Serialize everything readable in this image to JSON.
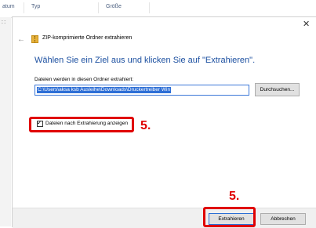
{
  "background": {
    "columns": [
      "atum",
      "Typ",
      "Größe"
    ]
  },
  "dialog": {
    "title": "ZIP-komprimierte Ordner extrahieren",
    "heading": "Wählen Sie ein Ziel aus und klicken Sie auf \"Extrahieren\".",
    "path_label": "Dateien werden in diesen Ordner extrahiert:",
    "path_value": "C:\\Users\\aksa ksb Ausleihe\\Downloads\\Druckertreiber Win",
    "browse_label": "Durchsuchen...",
    "checkbox_label": "Dateien nach Extrahierung anzeigen",
    "checkbox_checked": true,
    "extract_label": "Extrahieren",
    "cancel_label": "Abbrechen"
  },
  "annotations": {
    "step1": "5.",
    "step2": "5."
  },
  "colors": {
    "accent": "#1b4fa0",
    "selection": "#2e6fd6",
    "annotation": "#e00000"
  },
  "icons": {
    "back": "back-arrow-icon",
    "close": "close-icon",
    "zip": "zip-folder-icon"
  }
}
